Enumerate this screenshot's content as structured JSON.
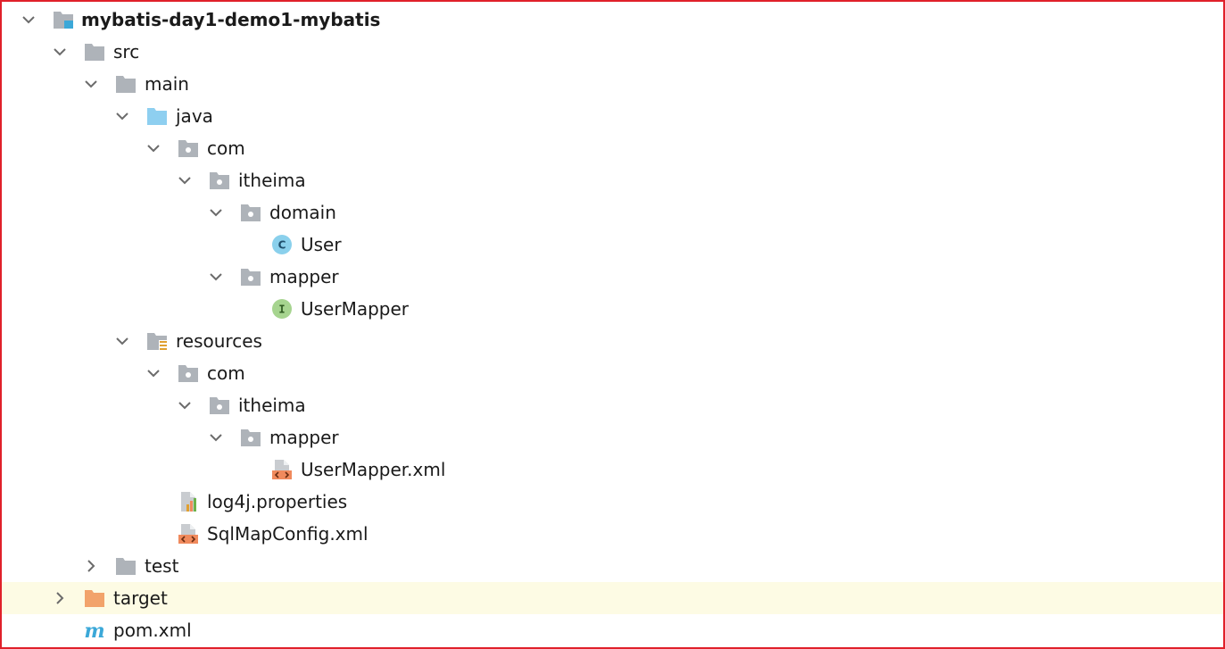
{
  "tree": [
    {
      "label": "mybatis-day1-demo1-mybatis",
      "icon": "module-folder-icon",
      "expanded": true
    },
    {
      "label": "src",
      "icon": "folder-icon",
      "expanded": true
    },
    {
      "label": "main",
      "icon": "folder-icon",
      "expanded": true
    },
    {
      "label": "java",
      "icon": "source-root-folder-icon",
      "expanded": true
    },
    {
      "label": "com",
      "icon": "package-icon",
      "expanded": true
    },
    {
      "label": "itheima",
      "icon": "package-icon",
      "expanded": true
    },
    {
      "label": "domain",
      "icon": "package-icon",
      "expanded": true
    },
    {
      "label": "User",
      "icon": "java-class-icon"
    },
    {
      "label": "mapper",
      "icon": "package-icon",
      "expanded": true
    },
    {
      "label": "UserMapper",
      "icon": "java-interface-icon"
    },
    {
      "label": "resources",
      "icon": "resources-root-folder-icon",
      "expanded": true
    },
    {
      "label": "com",
      "icon": "package-icon",
      "expanded": true
    },
    {
      "label": "itheima",
      "icon": "package-icon",
      "expanded": true
    },
    {
      "label": "mapper",
      "icon": "package-icon",
      "expanded": true
    },
    {
      "label": "UserMapper.xml",
      "icon": "xml-file-icon"
    },
    {
      "label": "log4j.properties",
      "icon": "properties-file-icon"
    },
    {
      "label": "SqlMapConfig.xml",
      "icon": "xml-file-icon"
    },
    {
      "label": "test",
      "icon": "folder-icon",
      "expanded": false
    },
    {
      "label": "target",
      "icon": "excluded-folder-icon",
      "expanded": false,
      "highlighted": true
    },
    {
      "label": "pom.xml",
      "icon": "maven-pom-icon"
    }
  ],
  "colors": {
    "frame_border": "#e0202a",
    "folder": "#aeb3b9",
    "source_root": "#8ecff0",
    "excluded": "#f2a36b",
    "class_badge": "#8ad0ec",
    "interface_badge": "#a6d48f",
    "xml_accent": "#f08a5d",
    "maven_m": "#3ba8d8",
    "highlight_row": "#fdfbe4"
  }
}
